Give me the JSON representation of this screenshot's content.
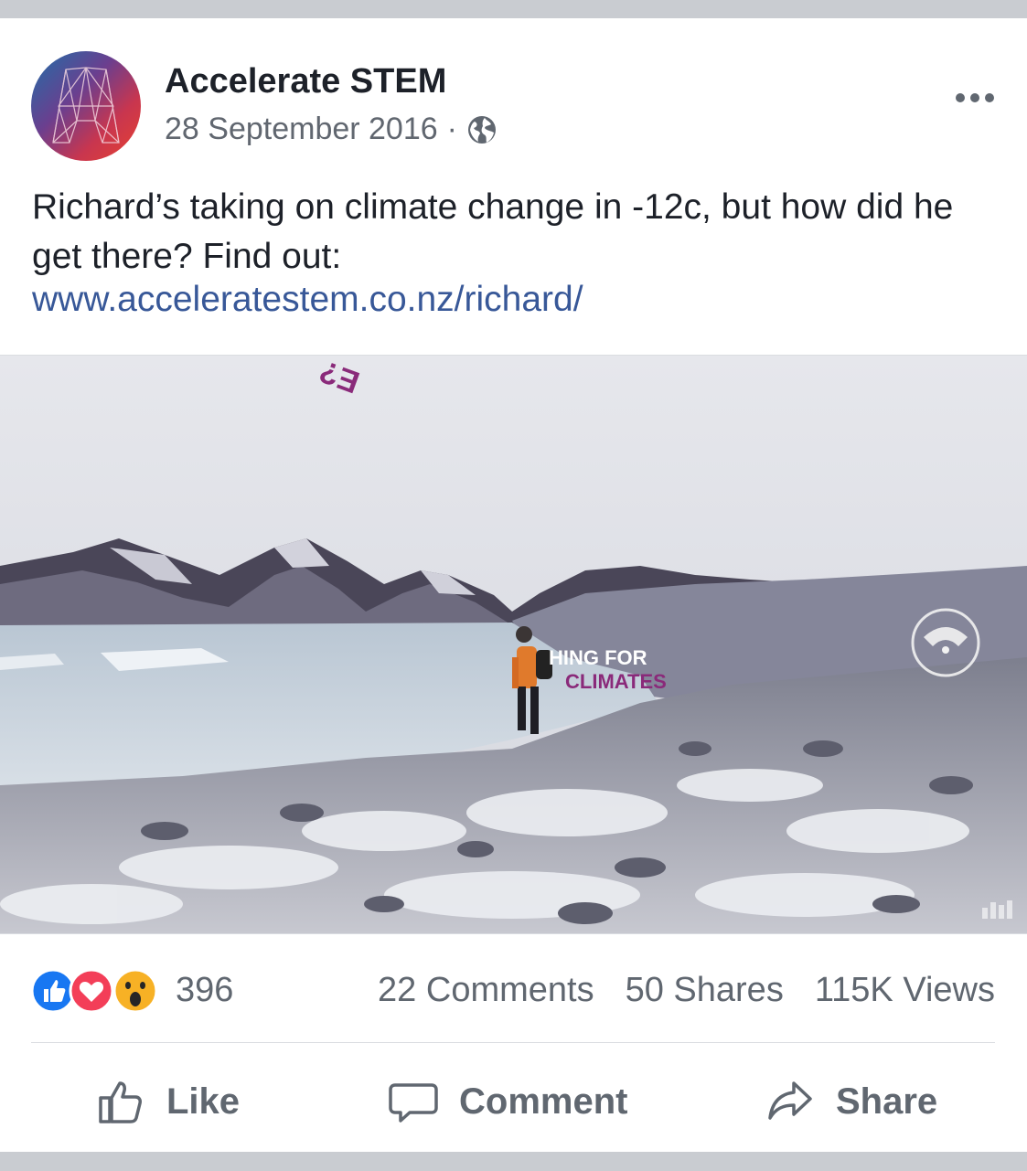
{
  "post": {
    "page_name": "Accelerate STEM",
    "date": "28 September 2016",
    "separator": "·",
    "privacy_icon": "globe-icon",
    "more_icon": "more-options-icon",
    "text": "Richard’s taking on climate change in -12c, but how did he get there? Find out:",
    "link": "www.acceleratestem.co.nz/richard/"
  },
  "media": {
    "overlay_line1": "HING FOR",
    "overlay_line2": "CLIMATES",
    "overlay_top": "E?",
    "icons": [
      "360-view-icon",
      "watermark-bars-icon"
    ]
  },
  "stats": {
    "reaction_icons": [
      "like-reaction-icon",
      "love-reaction-icon",
      "wow-reaction-icon"
    ],
    "reaction_count": "396",
    "comments": "22 Comments",
    "shares": "50 Shares",
    "views": "115K Views"
  },
  "actions": {
    "like": "Like",
    "comment": "Comment",
    "share": "Share"
  },
  "colors": {
    "link": "#385898",
    "like_blue": "#1877f2",
    "love_red": "#f33e58",
    "wow_yellow": "#f7b125",
    "overlay_purple": "#8a2a7a"
  }
}
